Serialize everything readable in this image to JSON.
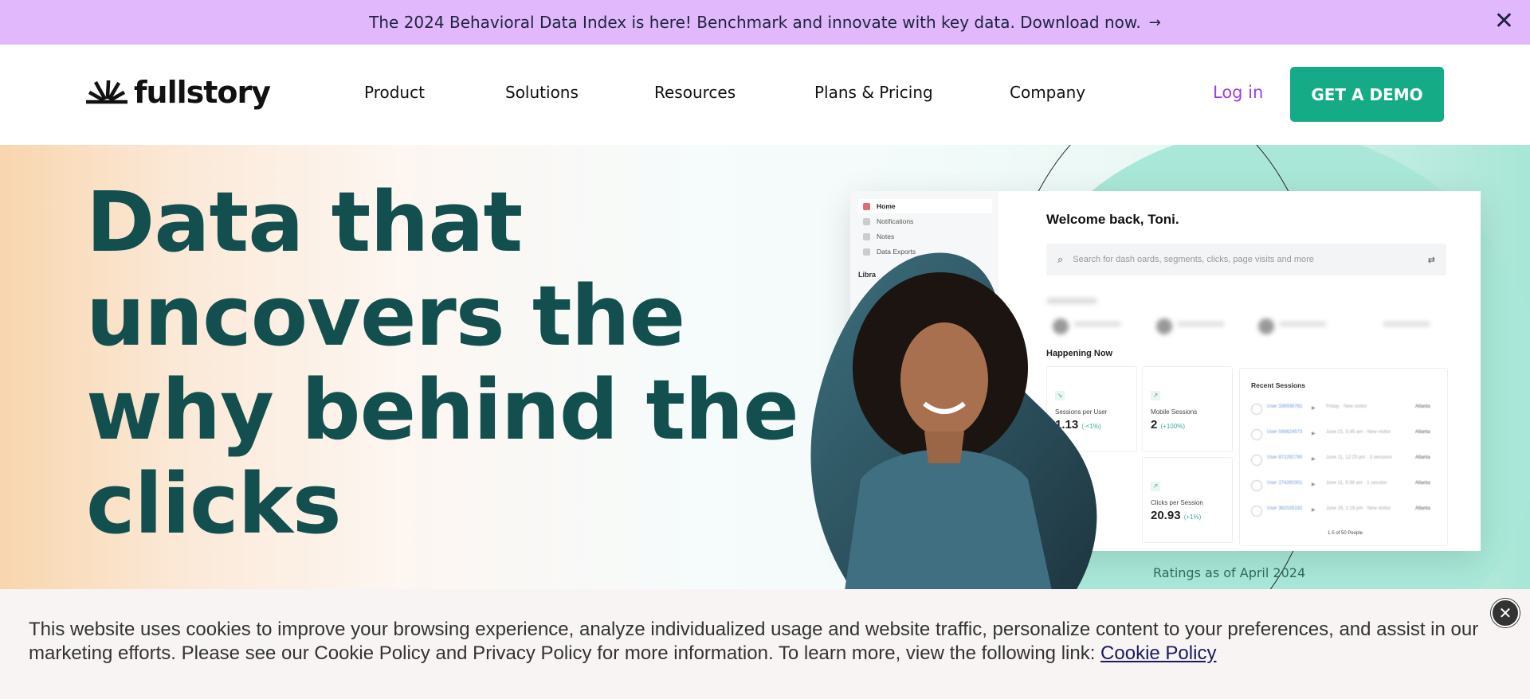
{
  "announcement": {
    "text": "The 2024 Behavioral Data Index is here! Benchmark and innovate with key data. Download now.",
    "arrow_icon": "→",
    "close_icon": "✕"
  },
  "nav": {
    "logo_text": "fullstory",
    "items": [
      "Product",
      "Solutions",
      "Resources",
      "Plans & Pricing",
      "Company"
    ],
    "login": "Log in",
    "cta": "GET A DEMO"
  },
  "hero": {
    "headline": "Data that uncovers the why behind the clicks",
    "ratings_note": "Ratings as of April 2024"
  },
  "dashboard": {
    "sidebar": [
      "Home",
      "Notifications",
      "Notes",
      "Data Exports"
    ],
    "library_label": "Libra",
    "welcome": "Welcome back, Toni.",
    "search_placeholder": "Search for dash oards, segments, clicks, page visits and more",
    "happening_now": "Happening Now",
    "metrics": [
      {
        "label": "Sessions per User",
        "value": "1.13",
        "change": "(-<1%)"
      },
      {
        "label": "Mobile Sessions",
        "value": "2",
        "change": "(+100%)"
      },
      {
        "label": "Clicks per Session",
        "value": "20.93",
        "change": "(+1%)"
      }
    ],
    "recent_sessions_title": "Recent Sessions",
    "sessions": [
      {
        "user": "User 336936762",
        "event": "Friday · New visitor",
        "city": "Atlanta"
      },
      {
        "user": "User 049624573",
        "event": "June 21, 5:45 am · New visitor",
        "city": "Atlanta"
      },
      {
        "user": "User 872292790",
        "event": "June 11, 12:23 pm · 3 sessions",
        "city": "Atlanta"
      },
      {
        "user": "User 274260301",
        "event": "June 11, 9:36 am · 1 session",
        "city": "Atlanta"
      },
      {
        "user": "User 382026182",
        "event": "June 16, 2:16 pm · New visitor",
        "city": "Atlanta"
      }
    ],
    "pager": "1-5 of 50 People"
  },
  "cookie": {
    "text": "This website uses cookies to improve your browsing experience, analyze individualized usage and website traffic, personalize content to your preferences, and assist in our marketing efforts. Please see our Cookie Policy and Privacy Policy for more information. To learn more, view the following link: ",
    "link": "Cookie Policy",
    "close_icon": "✕"
  },
  "colors": {
    "announcement_bg": "#e0b8fb",
    "brand_green": "#14ab86",
    "headline": "#134f4e",
    "login": "#9d3ee6"
  }
}
